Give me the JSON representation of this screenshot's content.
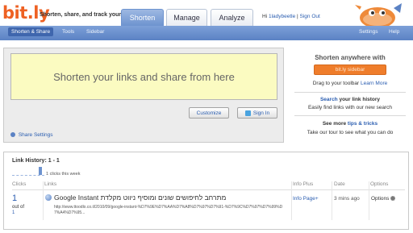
{
  "header": {
    "logo": "bit.ly",
    "tagline": "Shorten, share, and track your links",
    "tabs": [
      {
        "label": "Shorten",
        "active": true
      },
      {
        "label": "Manage",
        "active": false
      },
      {
        "label": "Analyze",
        "active": false
      }
    ],
    "greeting": "Hi",
    "username": "1ladybeetle",
    "separator": "|",
    "signout": "Sign Out"
  },
  "navbar": {
    "items": [
      "Shorten & Share",
      "Tools",
      "Sidebar"
    ],
    "right_items": [
      "Settings",
      "Help"
    ]
  },
  "shorten": {
    "placeholder": "Shorten your links and share from here",
    "customize_label": "Customize",
    "signin_label": "Sign In",
    "share_settings_label": "Share Settings"
  },
  "sidebar_promo": {
    "title": "Shorten anywhere with",
    "button_label": "bit.ly sidebar",
    "drag_text": "Drag to your toolbar",
    "learn_more": "Learn More",
    "search_link": "Search",
    "search_text": " your link history",
    "search_sub": "Easily find links with our new search",
    "tips_prefix": "See more ",
    "tips_link": "tips & tricks",
    "tips_sub": "Take our tour to see what you can do"
  },
  "history": {
    "title": "Link History: 1 - 1",
    "clicks_week": "1 clicks this week",
    "columns": [
      "Clicks",
      "Links",
      "Info Plus",
      "Date",
      "Options"
    ],
    "rows": [
      {
        "clicks": "1",
        "out_of": "out of",
        "of_value": "1",
        "title": "Google Instant מתרחב לחיפושים שונים ומוסיף ניווט מקלדת",
        "url": "http://www.ttoodlo.co.il/2010/09/google-instant-%D7%9E%D7%AA%D7%A8%D7%97%D7%91-%D7%9C%D7%97%D7%99%D7%A4%D7%95...",
        "info_plus": "Info Page+",
        "date": "3 mins ago",
        "options": "Options"
      }
    ]
  },
  "colors": {
    "brand_orange": "#ee6123",
    "nav_blue": "#6d93cf",
    "link_blue": "#2a5db0",
    "input_yellow": "#fbfbc1"
  }
}
